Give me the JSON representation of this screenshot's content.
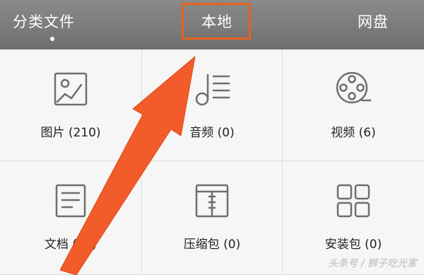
{
  "tabs": [
    {
      "label": "分类文件",
      "active": true
    },
    {
      "label": "本地",
      "highlighted": true
    },
    {
      "label": "网盘"
    }
  ],
  "categories": [
    {
      "label": "图片 (210)",
      "icon": "image-icon"
    },
    {
      "label": "音频 (0)",
      "icon": "music-note-icon"
    },
    {
      "label": "视频 (6)",
      "icon": "film-reel-icon"
    },
    {
      "label": "文档 (16)",
      "icon": "document-icon"
    },
    {
      "label": "压缩包 (0)",
      "icon": "archive-icon"
    },
    {
      "label": "安装包 (0)",
      "icon": "app-package-icon"
    }
  ],
  "watermark": "头条号 / 狮子吃光家",
  "colors": {
    "tab_bar": "#7a7a7a",
    "highlight": "#e8611f",
    "arrow": "#f25c2a",
    "icon_stroke": "#6e6e6e",
    "background": "#f4f4f4"
  }
}
